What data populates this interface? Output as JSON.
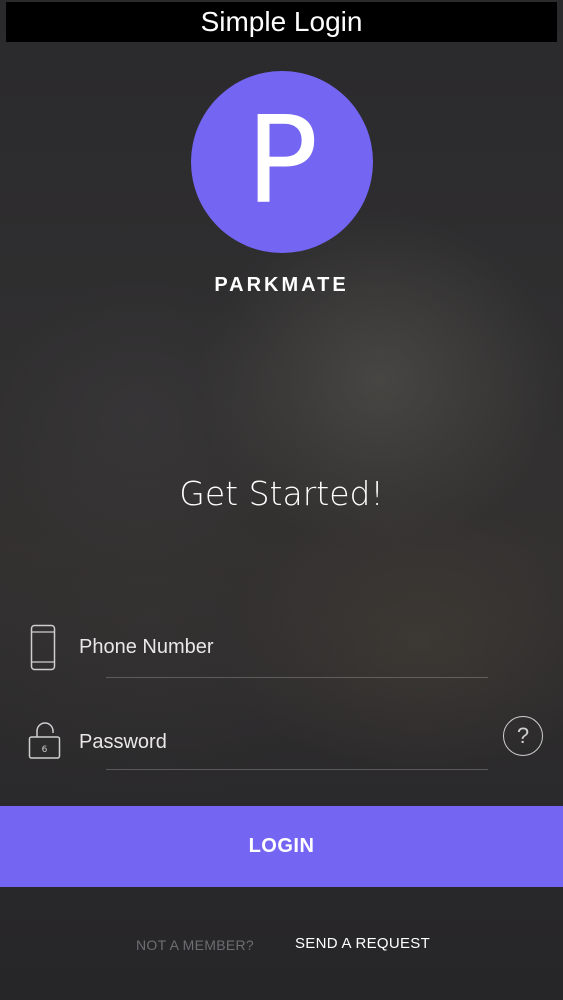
{
  "window": {
    "title": "Simple Login"
  },
  "logo": {
    "letter": "P",
    "color": "#7466f3"
  },
  "brand": {
    "name": "PARKMATE"
  },
  "headline": "Get Started!",
  "form": {
    "phone": {
      "placeholder": "Phone Number",
      "value": "",
      "icon": "phone-icon"
    },
    "password": {
      "placeholder": "Password",
      "value": "",
      "icon": "lock-icon"
    },
    "help_label": "?"
  },
  "actions": {
    "login_label": "LOGIN",
    "not_member_text": "NOT A MEMBER?",
    "send_request_label": "SEND A REQUEST"
  },
  "colors": {
    "accent": "#7466f3",
    "background": "#2b2a2d",
    "titlebar": "#000000"
  }
}
